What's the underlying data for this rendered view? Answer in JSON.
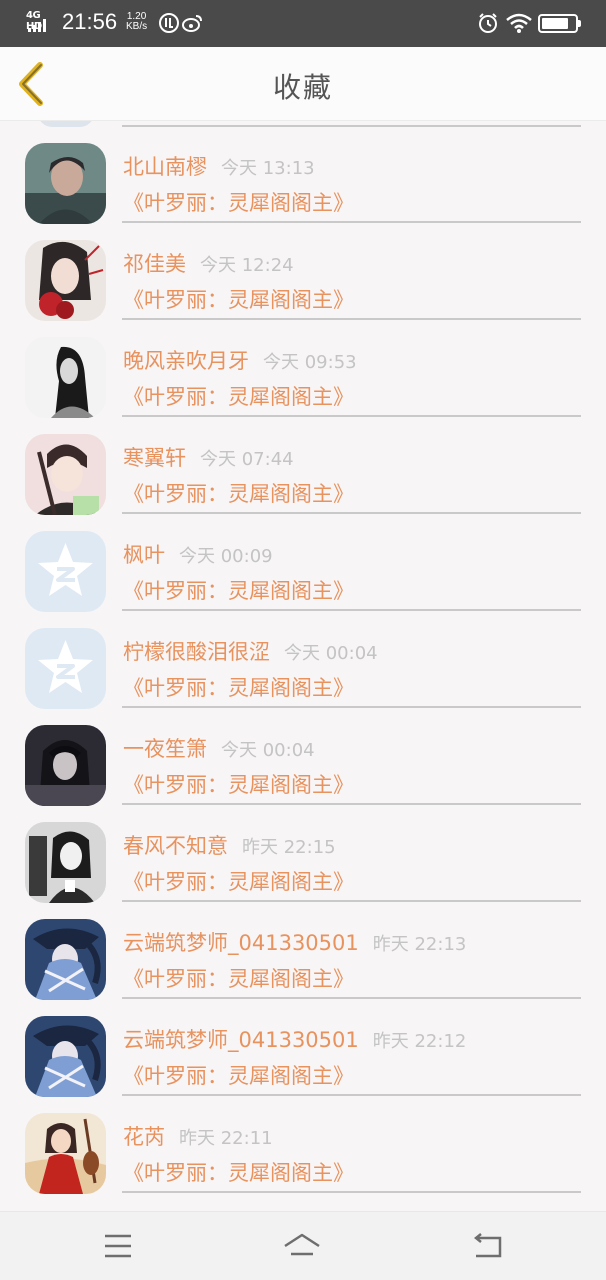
{
  "status_bar": {
    "network": "4G HD",
    "time": "21:56",
    "speed_value": "1.20",
    "speed_unit": "KB/s",
    "accent": "#ffffff"
  },
  "header": {
    "title": "收藏",
    "back_icon": "chevron-left-icon",
    "back_color": "#e0b21e"
  },
  "colors": {
    "name": "#e8925e",
    "time": "#c4c4c4",
    "divider": "#c9c9c9",
    "background": "#f7f5f6"
  },
  "entries": [
    {
      "name": "北山南樛",
      "time": "今天 13:13",
      "book": "《叶罗丽：灵犀阁阁主》",
      "avatar": "avatar-boy-dark"
    },
    {
      "name": "祁佳美",
      "time": "今天 12:24",
      "book": "《叶罗丽：灵犀阁阁主》",
      "avatar": "avatar-girl-red-flower"
    },
    {
      "name": "晚风亲吹月牙",
      "time": "今天 09:53",
      "book": "《叶罗丽：灵犀阁阁主》",
      "avatar": "avatar-girl-bw"
    },
    {
      "name": "寒翼轩",
      "time": "今天 07:44",
      "book": "《叶罗丽：灵犀阁阁主》",
      "avatar": "avatar-anime-boy"
    },
    {
      "name": "枫叶",
      "time": "今天 00:09",
      "book": "《叶罗丽：灵犀阁阁主》",
      "avatar": "avatar-qzone-default"
    },
    {
      "name": "柠檬很酸泪很涩",
      "time": "今天 00:04",
      "book": "《叶罗丽：灵犀阁阁主》",
      "avatar": "avatar-qzone-default"
    },
    {
      "name": "一夜笙箫",
      "time": "今天 00:04",
      "book": "《叶罗丽：灵犀阁阁主》",
      "avatar": "avatar-dark-figure"
    },
    {
      "name": "春风不知意",
      "time": "昨天 22:15",
      "book": "《叶罗丽：灵犀阁阁主》",
      "avatar": "avatar-sketch-girl"
    },
    {
      "name": "云端筑梦师_041330501",
      "time": "昨天 22:13",
      "book": "《叶罗丽：灵犀阁阁主》",
      "avatar": "avatar-blue-anime"
    },
    {
      "name": "云端筑梦师_041330501",
      "time": "昨天 22:12",
      "book": "《叶罗丽：灵犀阁阁主》",
      "avatar": "avatar-blue-anime"
    },
    {
      "name": "花芮",
      "time": "昨天 22:11",
      "book": "《叶罗丽：灵犀阁阁主》",
      "avatar": "avatar-red-hanfu"
    }
  ],
  "nav_bar": {
    "menu_icon": "menu-icon",
    "home_icon": "home-icon",
    "back_icon": "back-arrow-icon"
  }
}
